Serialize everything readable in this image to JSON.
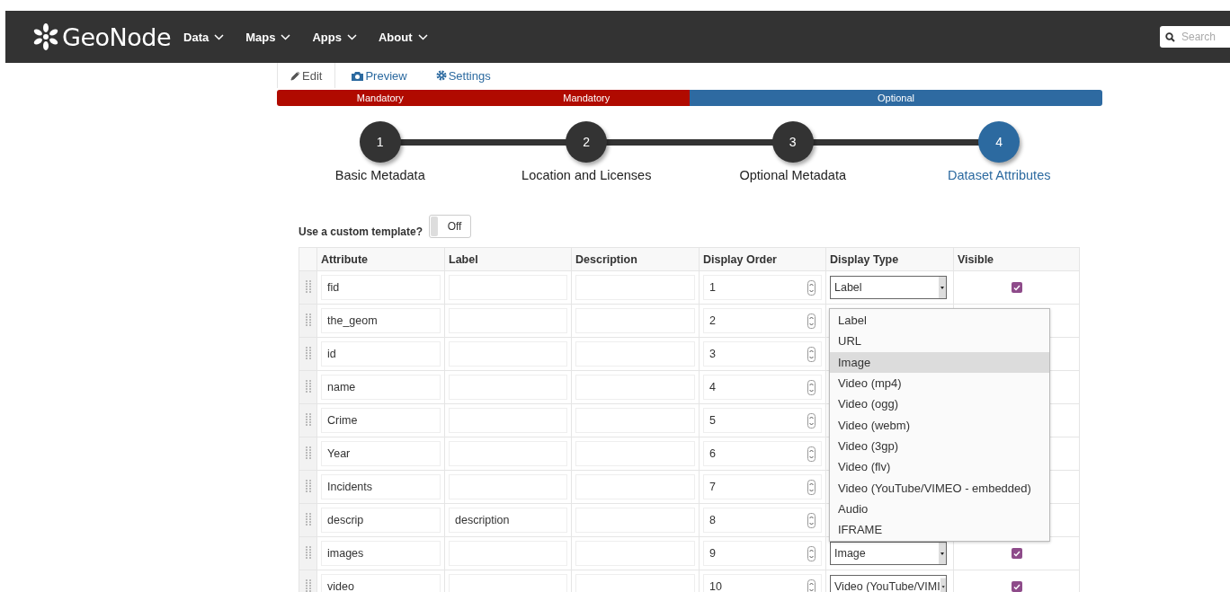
{
  "navbar": {
    "brand": "GeoNode",
    "menu": [
      {
        "label": "Data"
      },
      {
        "label": "Maps"
      },
      {
        "label": "Apps"
      },
      {
        "label": "About"
      }
    ],
    "search": {
      "placeholder": "Search"
    }
  },
  "tabs": [
    {
      "label": "Edit",
      "selected": true,
      "kind": "edit"
    },
    {
      "label": "Preview",
      "selected": false,
      "kind": "preview"
    },
    {
      "label": "Settings",
      "selected": false,
      "kind": "settings"
    }
  ],
  "progress": [
    {
      "label": "Mandatory",
      "kind": "mandatory"
    },
    {
      "label": "Mandatory",
      "kind": "mandatory"
    },
    {
      "label": "Optional",
      "kind": "optional"
    }
  ],
  "steps": [
    {
      "number": "1",
      "label": "Basic Metadata",
      "selected": false
    },
    {
      "number": "2",
      "label": "Location and Licenses",
      "selected": false
    },
    {
      "number": "3",
      "label": "Optional Metadata",
      "selected": false
    },
    {
      "number": "4",
      "label": "Dataset Attributes",
      "selected": true
    }
  ],
  "custom_template": {
    "label": "Use a custom template?",
    "toggle": "Off",
    "on": false
  },
  "table": {
    "columns": [
      "Attribute",
      "Label",
      "Description",
      "Display Order",
      "Display Type",
      "Visible"
    ],
    "rows": [
      {
        "attribute": "fid",
        "order": "1",
        "display_type": "Label",
        "visible": true
      },
      {
        "attribute": "the_geom",
        "order": "2"
      },
      {
        "attribute": "id",
        "order": "3"
      },
      {
        "attribute": "name",
        "order": "4"
      },
      {
        "attribute": "Crime",
        "order": "5"
      },
      {
        "attribute": "Year",
        "order": "6"
      },
      {
        "attribute": "Incidents",
        "order": "7"
      },
      {
        "attribute": "descrip",
        "label": "description",
        "order": "8"
      },
      {
        "attribute": "images",
        "order": "9",
        "display_type": "Image",
        "visible": true
      },
      {
        "attribute": "video",
        "order": "10",
        "display_type": "Video (YouTube/VIMI",
        "visible": true
      }
    ]
  },
  "dropdown": [
    {
      "label": "Label",
      "selected": false
    },
    {
      "label": "URL",
      "selected": false
    },
    {
      "label": "Image",
      "selected": true
    },
    {
      "label": "Video (mp4)",
      "selected": false
    },
    {
      "label": "Video (ogg)",
      "selected": false
    },
    {
      "label": "Video (webm)",
      "selected": false
    },
    {
      "label": "Video (3gp)",
      "selected": false
    },
    {
      "label": "Video (flv)",
      "selected": false
    },
    {
      "label": "Video (YouTube/VIMEO - embedded)",
      "selected": false
    },
    {
      "label": "Audio",
      "selected": false
    },
    {
      "label": "IFRAME",
      "selected": false
    }
  ]
}
